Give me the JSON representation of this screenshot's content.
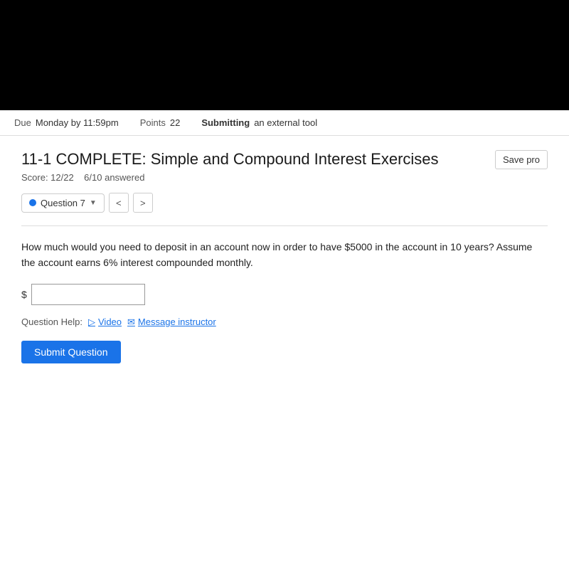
{
  "topBar": {
    "due_label": "Due",
    "due_value": "Monday by 11:59pm",
    "points_label": "Points",
    "points_value": "22",
    "submitting_label": "Submitting",
    "submitting_value": "an external tool"
  },
  "assignment": {
    "title": "11-1 COMPLETE: Simple and Compound Interest Exercises",
    "save_button": "Save pro",
    "score_label": "Score: 12/22",
    "answered_label": "6/10 answered"
  },
  "navigation": {
    "question_label": "Question 7",
    "prev_label": "<",
    "next_label": ">"
  },
  "question": {
    "text": "How much would you need to deposit in an account now in order to have $5000 in the account in 10 years? Assume the account earns 6% interest compounded monthly.",
    "dollar_sign": "$",
    "input_placeholder": ""
  },
  "help": {
    "label": "Question Help:",
    "video_label": "Video",
    "message_label": "Message instructor"
  },
  "submit": {
    "button_label": "Submit Question"
  }
}
